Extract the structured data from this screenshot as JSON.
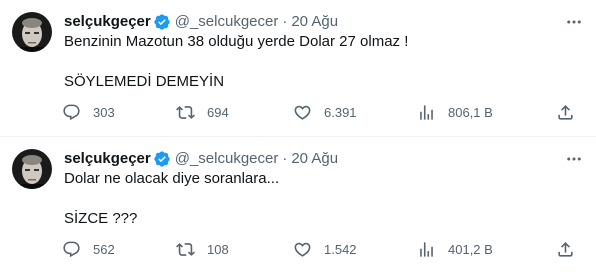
{
  "colors": {
    "text_primary": "#0f1419",
    "text_secondary": "#536471",
    "verified_blue": "#1d9bf0",
    "divider": "#eff3f4"
  },
  "tweets": [
    {
      "display_name": "selçukgeçer",
      "handle": "@_selcukgecer",
      "separator": "·",
      "date": "20 Ağu",
      "lines": [
        "Benzinin Mazotun 38 olduğu yerde Dolar 27 olmaz !",
        "SÖYLEMEDİ DEMEYİN"
      ],
      "stats": {
        "replies": "303",
        "retweets": "694",
        "likes": "6.391",
        "views": "806,1 B"
      }
    },
    {
      "display_name": "selçukgeçer",
      "handle": "@_selcukgecer",
      "separator": "·",
      "date": "20 Ağu",
      "lines": [
        "Dolar ne olacak diye soranlara...",
        "SİZCE ???"
      ],
      "stats": {
        "replies": "562",
        "retweets": "108",
        "likes": "1.542",
        "views": "401,2 B"
      }
    }
  ]
}
